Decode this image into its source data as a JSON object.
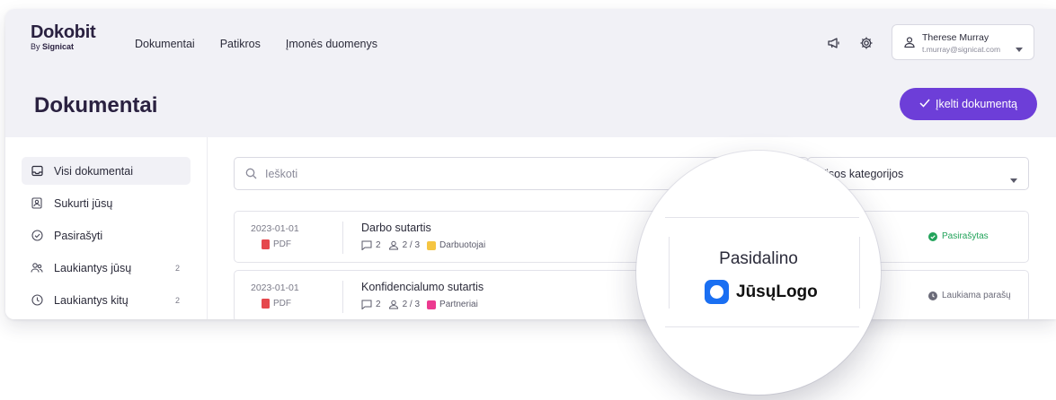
{
  "brand": {
    "name": "Dokobit",
    "by": "By",
    "partner": "Signicat"
  },
  "nav": {
    "items": [
      "Dokumentai",
      "Patikros",
      "Įmonės duomenys"
    ]
  },
  "user": {
    "name": "Therese Murray",
    "email": "t.murray@signicat.com"
  },
  "page": {
    "title": "Dokumentai"
  },
  "upload_button": {
    "label": "Įkelti dokumentą"
  },
  "sidebar": {
    "items": [
      {
        "label": "Visi dokumentai",
        "count": "",
        "icon": "inbox-icon"
      },
      {
        "label": "Sukurti jūsų",
        "count": "",
        "icon": "user-card-icon"
      },
      {
        "label": "Pasirašyti",
        "count": "",
        "icon": "check-circle-icon"
      },
      {
        "label": "Laukiantys jūsų",
        "count": "2",
        "icon": "users-icon"
      },
      {
        "label": "Laukiantys kitų",
        "count": "2",
        "icon": "clock-icon"
      }
    ]
  },
  "search": {
    "placeholder": "Ieškoti"
  },
  "category_select": {
    "value": "Visos kategorijos"
  },
  "documents": [
    {
      "date": "2023-01-01",
      "type": "PDF",
      "title": "Darbo sutartis",
      "comments": "2",
      "signers": "2 / 3",
      "tag": "Darbuotojai",
      "tag_color": "#f5c542",
      "status": "Pasirašytas",
      "status_color": "#22a35a"
    },
    {
      "date": "2023-01-01",
      "type": "PDF",
      "title": "Konfidencialumo sutartis",
      "comments": "2",
      "signers": "2 / 3",
      "tag": "Partneriai",
      "tag_color": "#ec3a8f",
      "status": "Laukiama parašų",
      "status_color": "#6a6a78"
    }
  ],
  "magnifier": {
    "label": "Pasidalino",
    "logo_text": "JūsųLogo"
  },
  "colors": {
    "accent": "#6d3ed8",
    "header_bg": "#f1f1f6",
    "brand_dark": "#2a2140"
  }
}
